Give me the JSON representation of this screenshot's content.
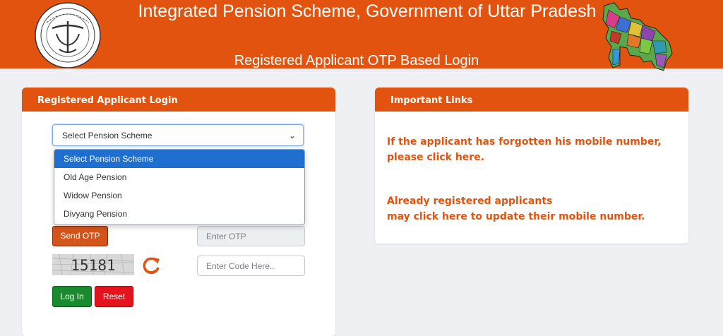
{
  "header": {
    "title": "Integrated Pension Scheme, Government of Uttar Pradesh",
    "subtitle": "Registered Applicant OTP Based Login",
    "emblem_icon": "up-government-emblem-icon",
    "map_icon": "uttar-pradesh-district-map-icon"
  },
  "login": {
    "heading": "Registered Applicant Login",
    "scheme_select": {
      "selected": "Select Pension Scheme",
      "options": [
        "Select Pension Scheme",
        "Old Age Pension",
        "Widow Pension",
        "Divyang Pension"
      ]
    },
    "send_otp_label": "Send OTP",
    "otp_placeholder": "Enter OTP",
    "captcha_code": "15181",
    "code_placeholder": "Enter Code Here..",
    "login_label": "Log In",
    "reset_label": "Reset"
  },
  "links": {
    "heading": "Important Links",
    "forgot_mobile": "If the applicant has forgotten his mobile number, please click here.",
    "update_mobile_line1": "Already registered applicants",
    "update_mobile_line2": "may click here to update their mobile number."
  },
  "colors": {
    "brand_orange": "#e2530f",
    "login_green": "#1a8a2e",
    "reset_red": "#e3141e",
    "selected_option_blue": "#1f6fd1"
  }
}
